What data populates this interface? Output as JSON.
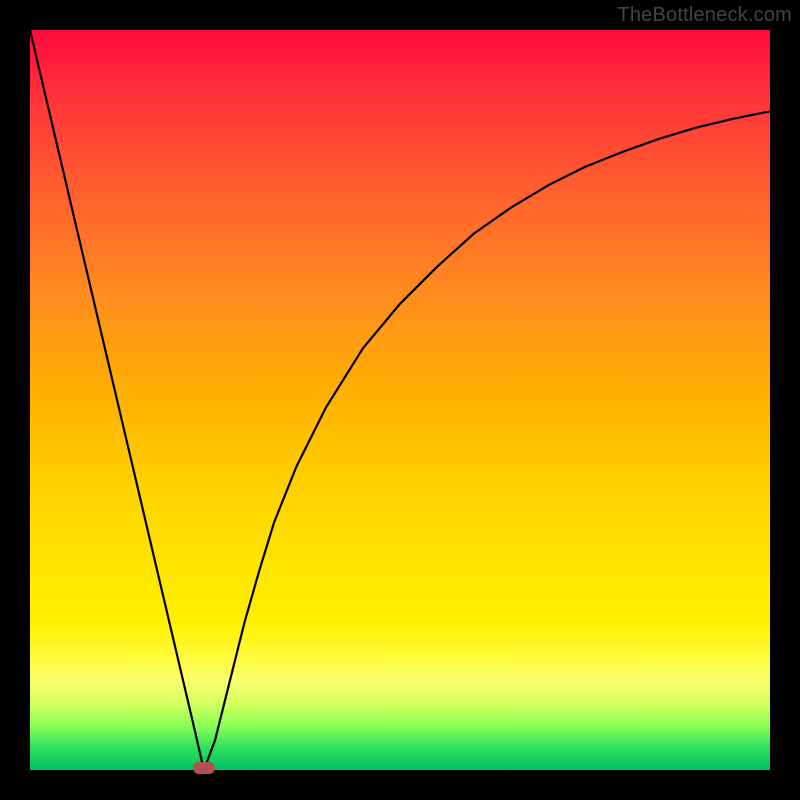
{
  "watermark": "TheBottleneck.com",
  "chart_data": {
    "type": "line",
    "title": "",
    "xlabel": "",
    "ylabel": "",
    "xlim": [
      0,
      100
    ],
    "ylim": [
      0,
      100
    ],
    "grid": false,
    "legend": false,
    "series": [
      {
        "name": "curve",
        "x": [
          0,
          2,
          4,
          6,
          8,
          10,
          12,
          14,
          16,
          18,
          20,
          22,
          23.5,
          25,
          27,
          29,
          31,
          33,
          36,
          40,
          45,
          50,
          55,
          60,
          65,
          70,
          75,
          80,
          85,
          90,
          95,
          100
        ],
        "y": [
          100,
          91.5,
          83,
          74.5,
          66,
          57.5,
          49,
          40.5,
          32,
          23.5,
          15,
          6.5,
          0,
          4,
          12,
          20,
          27,
          33.5,
          41,
          49,
          57,
          63,
          68,
          72.5,
          76,
          79,
          81.5,
          83.5,
          85.3,
          86.8,
          88,
          89
        ]
      }
    ],
    "marker": {
      "x": 23.5,
      "y": 0
    },
    "background_gradient": {
      "top": "#ff0a3c",
      "mid": "#ffd400",
      "bottom": "#00c060"
    }
  }
}
